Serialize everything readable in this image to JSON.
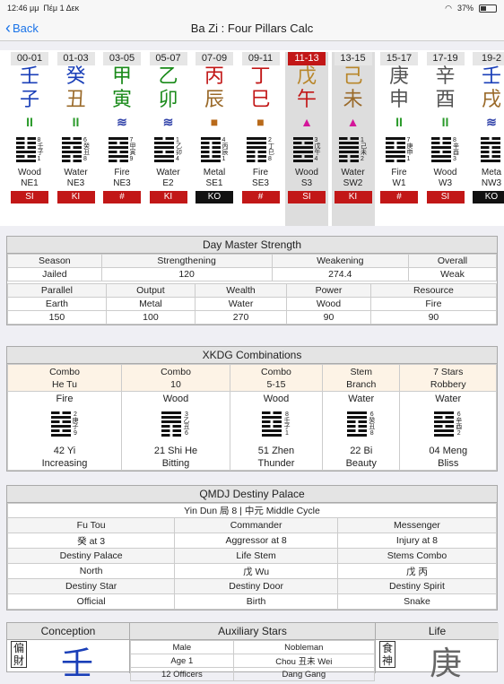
{
  "status": {
    "time": "12:46 μμ",
    "date": "Πέμ 1 Δεκ",
    "battery": "37%"
  },
  "nav": {
    "back": "Back",
    "title": "Ba Zi : Four Pillars Calc"
  },
  "pillars": [
    {
      "time": "00-01",
      "stem": "壬",
      "stem_color": "#1a3fb8",
      "branch": "子",
      "branch_color": "#1a3fb8",
      "sym": "II",
      "sym_color": "#2a9a2a",
      "nums": [
        "8",
        "壬",
        "子",
        "1"
      ],
      "hex": "000101",
      "elem": "Wood",
      "dir": "NE1",
      "badge": "SI",
      "badge_type": "red",
      "hl": false
    },
    {
      "time": "01-03",
      "stem": "癸",
      "stem_color": "#1a3fb8",
      "branch": "丑",
      "branch_color": "#9a6a2a",
      "sym": "II",
      "sym_color": "#2a9a2a",
      "nums": [
        "6",
        "癸",
        "丑",
        "8"
      ],
      "hex": "010100",
      "elem": "Water",
      "dir": "NE3",
      "badge": "KI",
      "badge_type": "red",
      "hl": false
    },
    {
      "time": "03-05",
      "stem": "甲",
      "stem_color": "#1a8a1a",
      "branch": "寅",
      "branch_color": "#1a8a1a",
      "sym": "≋",
      "sym_color": "#3344aa",
      "nums": [
        "7",
        "甲",
        "寅",
        "9"
      ],
      "hex": "101010",
      "elem": "Fire",
      "dir": "NE3",
      "badge": "#",
      "badge_type": "red",
      "hl": false
    },
    {
      "time": "05-07",
      "stem": "乙",
      "stem_color": "#1a8a1a",
      "branch": "卯",
      "branch_color": "#1a8a1a",
      "sym": "≋",
      "sym_color": "#3344aa",
      "nums": [
        "1",
        "乙",
        "卯",
        "4"
      ],
      "hex": "011011",
      "elem": "Water",
      "dir": "E2",
      "badge": "KI",
      "badge_type": "red",
      "hl": false
    },
    {
      "time": "07-09",
      "stem": "丙",
      "stem_color": "#c21717",
      "branch": "辰",
      "branch_color": "#9a6a2a",
      "sym": "■",
      "sym_color": "#b86a1a",
      "nums": [
        "4",
        "丙",
        "辰",
        "1"
      ],
      "hex": "100001",
      "elem": "Metal",
      "dir": "SE1",
      "badge": "KO",
      "badge_type": "blk",
      "hl": false
    },
    {
      "time": "09-11",
      "stem": "丁",
      "stem_color": "#c21717",
      "branch": "巳",
      "branch_color": "#c21717",
      "sym": "■",
      "sym_color": "#b86a1a",
      "nums": [
        "2",
        "丁",
        "巳",
        "8"
      ],
      "hex": "111000",
      "elem": "Fire",
      "dir": "SE3",
      "badge": "#",
      "badge_type": "red",
      "hl": false
    },
    {
      "time": "11-13",
      "stem": "戊",
      "stem_color": "#b8862a",
      "branch": "午",
      "branch_color": "#c21717",
      "sym": "▲",
      "sym_color": "#d4169a",
      "nums": [
        "3",
        "戊",
        "午",
        "4"
      ],
      "hex": "101101",
      "elem": "Wood",
      "dir": "S3",
      "badge": "SI",
      "badge_type": "red",
      "hl": true
    },
    {
      "time": "13-15",
      "stem": "己",
      "stem_color": "#b8862a",
      "branch": "未",
      "branch_color": "#9a6a2a",
      "sym": "▲",
      "sym_color": "#d4169a",
      "nums": [
        "1",
        "己",
        "未",
        "2"
      ],
      "hex": "011100",
      "elem": "Water",
      "dir": "SW2",
      "badge": "KI",
      "badge_type": "red",
      "hl": true
    },
    {
      "time": "15-17",
      "stem": "庚",
      "stem_color": "#555",
      "branch": "申",
      "branch_color": "#555",
      "sym": "II",
      "sym_color": "#2a9a2a",
      "nums": [
        "7",
        "庚",
        "申",
        "1"
      ],
      "hex": "100110",
      "elem": "Fire",
      "dir": "W1",
      "badge": "#",
      "badge_type": "red",
      "hl": false
    },
    {
      "time": "17-19",
      "stem": "辛",
      "stem_color": "#555",
      "branch": "酉",
      "branch_color": "#555",
      "sym": "II",
      "sym_color": "#2a9a2a",
      "nums": [
        "8",
        "辛",
        "酉",
        "3"
      ],
      "hex": "001011",
      "elem": "Wood",
      "dir": "W3",
      "badge": "SI",
      "badge_type": "red",
      "hl": false
    },
    {
      "time": "19-2",
      "stem": "壬",
      "stem_color": "#1a3fb8",
      "branch": "戌",
      "branch_color": "#9a6a2a",
      "sym": "≋",
      "sym_color": "#3344aa",
      "nums": [
        "",
        "",
        "",
        ""
      ],
      "hex": "010001",
      "elem": "Meta",
      "dir": "NW3",
      "badge": "KO",
      "badge_type": "blk",
      "hl": false
    }
  ],
  "dms": {
    "title": "Day Master Strength",
    "row1_headers": [
      "Season",
      "Strengthening",
      "Weakening",
      "Overall"
    ],
    "row1_values": [
      "Jailed",
      "120",
      "274.4",
      "Weak"
    ],
    "row2_headers": [
      "Parallel",
      "Output",
      "Wealth",
      "Power",
      "Resource"
    ],
    "row2_elems": [
      "Earth",
      "Metal",
      "Water",
      "Wood",
      "Fire"
    ],
    "row2_values": [
      "150",
      "100",
      "270",
      "90",
      "90"
    ]
  },
  "xkdg": {
    "title": "XKDG Combinations",
    "headers": [
      [
        "Combo",
        "He Tu"
      ],
      [
        "Combo",
        "10"
      ],
      [
        "Combo",
        "5-15"
      ],
      [
        "Stem",
        "Branch"
      ],
      [
        "7 Stars",
        "Robbery"
      ]
    ],
    "cells": [
      {
        "elem": "Fire",
        "nums": [
          "2",
          "庚",
          "子",
          "9"
        ],
        "hex": "010101",
        "name": "42 Yi",
        "desc": "Increasing"
      },
      {
        "elem": "Wood",
        "nums": [
          "3",
          "乙",
          "丑",
          "6"
        ],
        "hex": "111000",
        "name": "21 Shi He",
        "desc": "Bitting"
      },
      {
        "elem": "Wood",
        "nums": [
          "8",
          "壬",
          "子",
          "1"
        ],
        "hex": "010011",
        "name": "51 Zhen",
        "desc": "Thunder"
      },
      {
        "elem": "Water",
        "nums": [
          "6",
          "癸",
          "丑",
          "8"
        ],
        "hex": "110001",
        "name": "22 Bi",
        "desc": "Beauty"
      },
      {
        "elem": "Water",
        "nums": [
          "6",
          "辛",
          "酉",
          "2"
        ],
        "hex": "101011",
        "name": "04 Meng",
        "desc": "Bliss"
      }
    ]
  },
  "qmdj": {
    "title": "QMDJ Destiny Palace",
    "subtitle": "Yin Dun 局 8 | 中元 Middle Cycle",
    "rows": [
      [
        "Fu Tou",
        "Commander",
        "Messenger"
      ],
      [
        "癸 at 3",
        "Aggressor at 8",
        "Injury at 8"
      ],
      [
        "Destiny Palace",
        "Life Stem",
        "Stems Combo"
      ],
      [
        "North",
        "戊 Wu",
        "戊 丙"
      ],
      [
        "Destiny Star",
        "Destiny Door",
        "Destiny Spirit"
      ],
      [
        "Official",
        "Birth",
        "Snake"
      ]
    ]
  },
  "bottom": {
    "conception": "Conception",
    "aux": "Auxiliary Stars",
    "life": "Life",
    "aux_rows": [
      [
        "Male",
        "Nobleman"
      ],
      [
        "Age 1",
        "Chou 丑未 Wei"
      ],
      [
        "12 Officers",
        "Dang Gang"
      ]
    ],
    "conc_vert": "偏財",
    "conc_char": "壬",
    "life_vert": "食神",
    "life_char": "庚"
  }
}
